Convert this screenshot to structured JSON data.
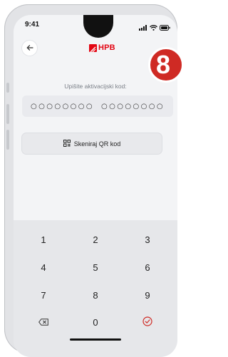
{
  "status": {
    "time": "9:41"
  },
  "brand": {
    "name": "HPB",
    "color": "#e30613"
  },
  "step_badge": "8",
  "prompt": "Upišite aktivacijski kod:",
  "code": {
    "group1": "○○○○○○○○",
    "group2": "○○○○○○○○"
  },
  "qr_button": {
    "label": "Skeniraj QR kod"
  },
  "keypad": {
    "k1": "1",
    "k2": "2",
    "k3": "3",
    "k4": "4",
    "k5": "5",
    "k6": "6",
    "k7": "7",
    "k8": "8",
    "k9": "9",
    "k0": "0"
  },
  "icons": {
    "back": "arrow-left-icon",
    "qr": "qr-code-icon",
    "delete": "backspace-icon",
    "confirm": "check-circle-icon"
  }
}
